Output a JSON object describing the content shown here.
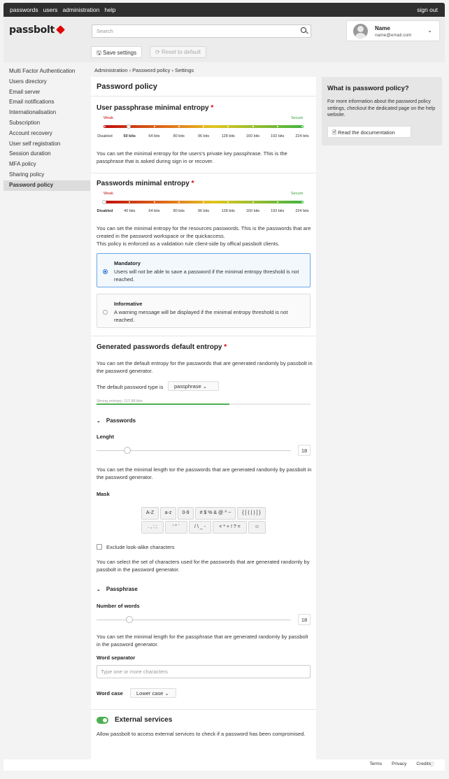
{
  "topnav": {
    "items": [
      "passwords",
      "users",
      "administration",
      "help"
    ],
    "signout": "sign out"
  },
  "logo": "passbolt",
  "search": {
    "placeholder": "Search"
  },
  "profile": {
    "name": "Name",
    "email": "name@email.com"
  },
  "actions": {
    "save": "Save settings",
    "reset": "Reset to default"
  },
  "sidebar": {
    "items": [
      "Multi Factor Authentication",
      "Users directory",
      "Email server",
      "Email notifications",
      "Internationalisation",
      "Subscription",
      "Account recovery",
      "User self registration",
      "Session duration",
      "MFA policy",
      "Sharing policy",
      "Password policy"
    ],
    "active_index": 11
  },
  "breadcrumb": "Administration › Password policy › Settings",
  "main": {
    "title": "Password policy",
    "user_entropy": {
      "title": "User passphrase minimal entropy",
      "weak": "Weak",
      "secure": "Secure",
      "labels": [
        "Disabled",
        "50 bits",
        "64 bits",
        "80 bits",
        "96 bits",
        "128 bits",
        "160 bits",
        "192 bits",
        "224 bits"
      ],
      "selected_index": 1,
      "desc": "You can set the minimal entropy for the users's private key passphrase. This is the passphrase that is asked during sign in or recover."
    },
    "password_entropy": {
      "title": "Passwords minimal entropy",
      "weak": "Weak",
      "secure": "Secure",
      "labels": [
        "Disabled",
        "40 bits",
        "64 bits",
        "80 bits",
        "96 bits",
        "128 bits",
        "160 bits",
        "192 bits",
        "224 bits"
      ],
      "selected_index": 0,
      "desc1": "You can set the minimal entropy for the resources passwords. This is the passwords that are created in the password workspace or the quickaccess.",
      "desc2": "This policy is enforced as a validation rule client-side by offical passbolt clients.",
      "mandatory_title": "Mandatory",
      "mandatory_desc": "Users will not be able to save a password if the minimal entropy threshold is not reached.",
      "informative_title": "Informative",
      "informative_desc": "A warning message will be displayed if the minimal entropy threshold is not reached."
    },
    "generated": {
      "title": "Generated passwords default entropy",
      "desc": "You can set the default entropy for the passwords that are generated randomly by passbolt in the password generator.",
      "type_label": "The default password type is",
      "type_value": "passphrase",
      "strength": "Strong entropy: 117.98 bits",
      "strength_fraction": 0.62
    },
    "passwords": {
      "heading": "Passwords",
      "length_label": "Lenght",
      "length_value": "18",
      "length_fraction": 0.14,
      "length_desc": "You can set the minimal length tor the passwords that are generated randomly by passbolt in the password generator.",
      "mask_label": "Mask",
      "mask_row1": [
        "A-Z",
        "a-z",
        "0-9",
        "# $ % & @ ^ ~",
        "{ [ ( | ) ] }"
      ],
      "mask_row2": [
        ". , : ;",
        "' \" `",
        "/ \\ _ -",
        "< * + ! ? =",
        "emoji"
      ],
      "exclude": "Exclude look-alike characters",
      "mask_desc": "You can select the set of characters used for the passwords that are generated randomly by passbolt in the password generator."
    },
    "passphrase": {
      "heading": "Passphrase",
      "words_label": "Number of words",
      "words_value": "18",
      "words_fraction": 0.15,
      "words_desc": "You can set the minimal length for the passphrase that are generated randomly by passbolt in the password generator.",
      "separator_label": "Word separator",
      "separator_placeholder": "Type one or more characters",
      "case_label": "Word case",
      "case_value": "Lower case"
    },
    "external": {
      "title": "External services",
      "desc": "Allow passbolt to access external services to check if a password has been compromised."
    }
  },
  "help": {
    "title": "What is password policy?",
    "desc": "For more information about the password policy settings, checkout the dedicated page on the help website.",
    "button": "Read the documentation"
  },
  "footer": {
    "links": [
      "Terms",
      "Privacy",
      "Credits"
    ]
  },
  "colors": {
    "brand": "#e10600",
    "topbar": "#2f2f2f",
    "accent_blue": "#2a73c9",
    "toggle_green": "#4caf50"
  }
}
